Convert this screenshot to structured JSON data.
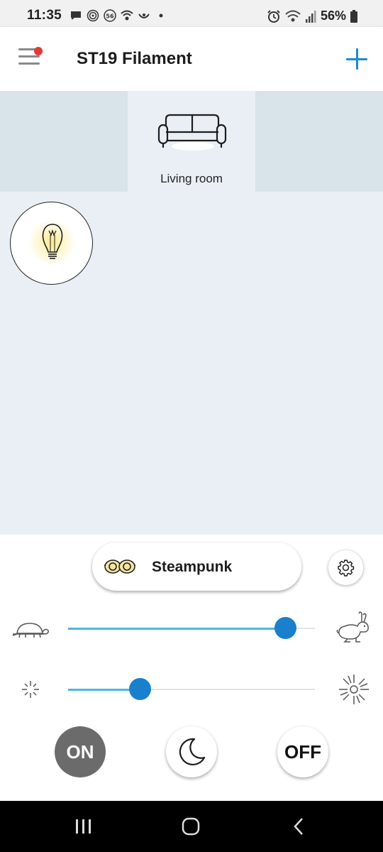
{
  "status_bar": {
    "time": "11:35",
    "battery": "56%",
    "icons_left": [
      "chat-icon",
      "fingerprint-icon",
      "badge-56-icon",
      "wifi-shield-icon",
      "app-icon",
      "dot-icon"
    ],
    "icons_right": [
      "alarm-icon",
      "wifi-icon",
      "signal-icon",
      "battery-icon"
    ]
  },
  "header": {
    "title": "ST19 Filament",
    "menu_icon": "hamburger-icon",
    "notification_dot_color": "#e53935",
    "add_icon": "plus-icon",
    "accent_color": "#1a8ad2"
  },
  "rooms": [
    {
      "label": "Living room",
      "icon": "sofa-icon",
      "selected": true
    }
  ],
  "devices": [
    {
      "icon": "filament-bulb-icon",
      "state": "on"
    }
  ],
  "controls": {
    "scene": {
      "label": "Steampunk",
      "icon": "steampunk-goggles-icon"
    },
    "settings_icon": "gear-icon",
    "speed_slider": {
      "left_icon": "turtle-icon",
      "right_icon": "rabbit-icon",
      "value_percent": 88
    },
    "brightness_slider": {
      "left_icon": "dim-sun-icon",
      "right_icon": "bright-sun-icon",
      "value_percent": 29
    },
    "on_label": "ON",
    "off_label": "OFF",
    "night_icon": "moon-icon"
  },
  "nav_bar": {
    "recents_icon": "recents-icon",
    "home_icon": "home-icon",
    "back_icon": "back-icon"
  }
}
